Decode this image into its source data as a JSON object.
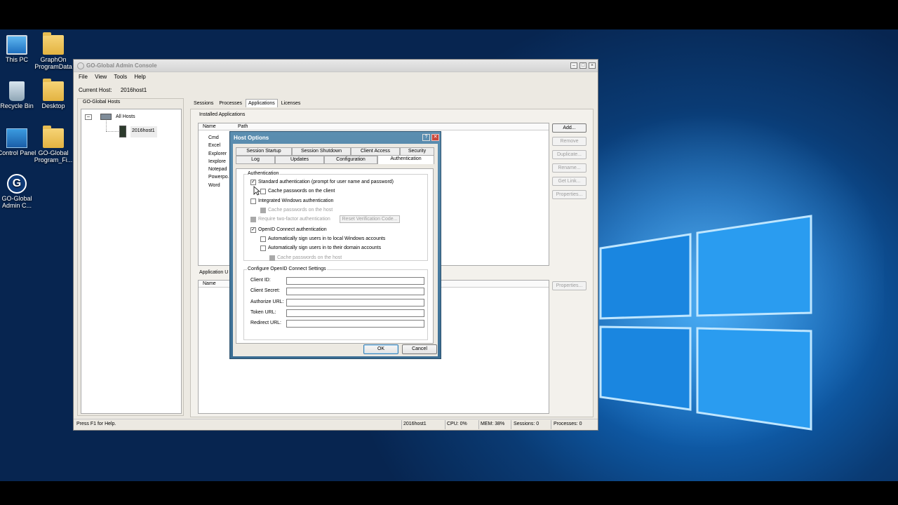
{
  "desktop": {
    "icons": [
      {
        "label": "This PC",
        "icon": "this-pc-icon"
      },
      {
        "label": "GraphOn ProgramData",
        "icon": "folder-icon"
      },
      {
        "label": "Recycle Bin",
        "icon": "recycle-bin-icon"
      },
      {
        "label": "Desktop",
        "icon": "folder-icon"
      },
      {
        "label": "Control Panel",
        "icon": "control-panel-icon"
      },
      {
        "label": "GO-Global Program_Fi...",
        "icon": "folder-icon"
      },
      {
        "label": "GO-Global Admin C...",
        "icon": "go-global-icon"
      }
    ]
  },
  "window": {
    "title": "GO-Global Admin Console",
    "menu": [
      "File",
      "View",
      "Tools",
      "Help"
    ],
    "current_host_label": "Current Host:",
    "current_host_value": "2016host1",
    "hosts_panel_label": "GO-Global Hosts",
    "tree": {
      "root": "All Hosts",
      "child": "2016host1"
    },
    "tabs": [
      "Sessions",
      "Processes",
      "Applications",
      "Licenses"
    ],
    "active_tab": "Applications",
    "installed_label": "Installed Applications",
    "columns": [
      "Name",
      "Path"
    ],
    "apps": [
      "Cmd",
      "Excel",
      "Explorer",
      "Iexplore",
      "Notepad",
      "Powerpo...",
      "Word"
    ],
    "app_users_label": "Application U",
    "users_column": "Name",
    "buttons": [
      "Add...",
      "Remove",
      "Duplicate...",
      "Rename...",
      "Get Link...",
      "Properties..."
    ],
    "users_properties": "Properties...",
    "status": {
      "help": "Press F1 for Help.",
      "host": "2016host1",
      "cpu": "CPU: 0%",
      "mem": "MEM: 38%",
      "sessions": "Sessions: 0",
      "processes": "Processes: 0"
    }
  },
  "dialog": {
    "title": "Host Options",
    "help_glyph": "?",
    "close_glyph": "✕",
    "tabs_row1": [
      "Session Startup",
      "Session Shutdown",
      "Client Access",
      "Security"
    ],
    "tabs_row2": [
      "Log",
      "Updates",
      "Configuration",
      "Authentication"
    ],
    "active_tab": "Authentication",
    "auth_group": "Authentication",
    "opt_standard": "Standard authentication (prompt for user name and password)",
    "opt_cache_client": "Cache passwords on the client",
    "opt_integrated": "Integrated Windows authentication",
    "opt_cache_host1": "Cache passwords on the host",
    "opt_two_factor": "Require two-factor authentication",
    "reset_button": "Reset Verification Code...",
    "opt_openid": "OpenID Connect authentication",
    "opt_auto_local": "Automatically sign users in to local Windows accounts",
    "opt_auto_domain": "Automatically sign users in to their domain accounts",
    "opt_cache_host2": "Cache passwords on the host",
    "config_group": "Configure OpenID Connect Settings",
    "fields": [
      "Client ID:",
      "Client Secret:",
      "Authorize URL:",
      "Token URL:",
      "Redirect URL:"
    ],
    "ok": "OK",
    "cancel": "Cancel",
    "checked": {
      "standard": true,
      "openid": true
    }
  }
}
